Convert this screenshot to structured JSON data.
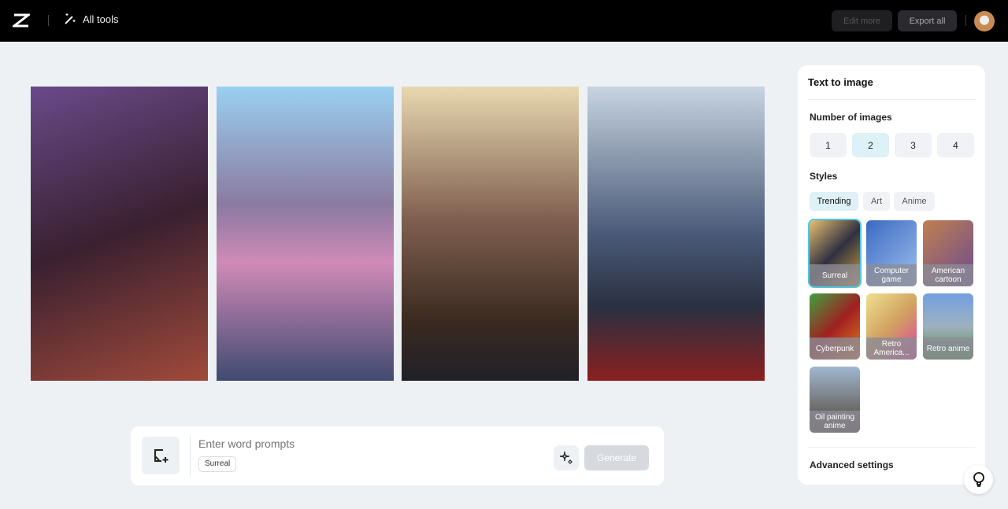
{
  "header": {
    "all_tools": "All tools",
    "edit_more": "Edit more",
    "export_all": "Export all"
  },
  "images": [
    {
      "gradient": "linear-gradient(160deg,#6a4a8a,#3a2030 50%,#a04a3a)"
    },
    {
      "gradient": "linear-gradient(180deg,#9ad0f0,#8a7aa0 40%,#d08ab8 60%,#404a70)"
    },
    {
      "gradient": "linear-gradient(180deg,#e8d8b0,#806050 45%,#3a2a20 80%,#202028)"
    },
    {
      "gradient": "linear-gradient(180deg,#c8d4e0,#4a5a78 50%,#2a3040 75%,#8a2020)"
    }
  ],
  "panel": {
    "title": "Text to image",
    "number_label": "Number of images",
    "numbers": [
      "1",
      "2",
      "3",
      "4"
    ],
    "selected_number": "2",
    "styles_label": "Styles",
    "style_tabs": [
      "Trending",
      "Art",
      "Anime"
    ],
    "styles": [
      {
        "label": "Surreal",
        "gradient": "linear-gradient(135deg,#e8c070,#303040,#d0a040)",
        "selected": true
      },
      {
        "label": "Computer game",
        "gradient": "linear-gradient(135deg,#3a6ac0,#a0c0f0)"
      },
      {
        "label": "American cartoon",
        "gradient": "linear-gradient(135deg,#c08050,#6a4a90)"
      },
      {
        "label": "Cyberpunk",
        "gradient": "linear-gradient(135deg,#40a040,#a02020,#e08020)"
      },
      {
        "label": "Retro America...",
        "gradient": "linear-gradient(135deg,#f0e090,#d0a060,#e040a0)"
      },
      {
        "label": "Retro anime",
        "gradient": "linear-gradient(180deg,#70a0e0,#a0b0c0,#4a9040)"
      },
      {
        "label": "Oil painting anime",
        "gradient": "linear-gradient(180deg,#a0b8d0,#504030)"
      }
    ],
    "advanced": "Advanced settings"
  },
  "prompt": {
    "placeholder": "Enter word prompts",
    "tag": "Surreal",
    "generate": "Generate"
  }
}
